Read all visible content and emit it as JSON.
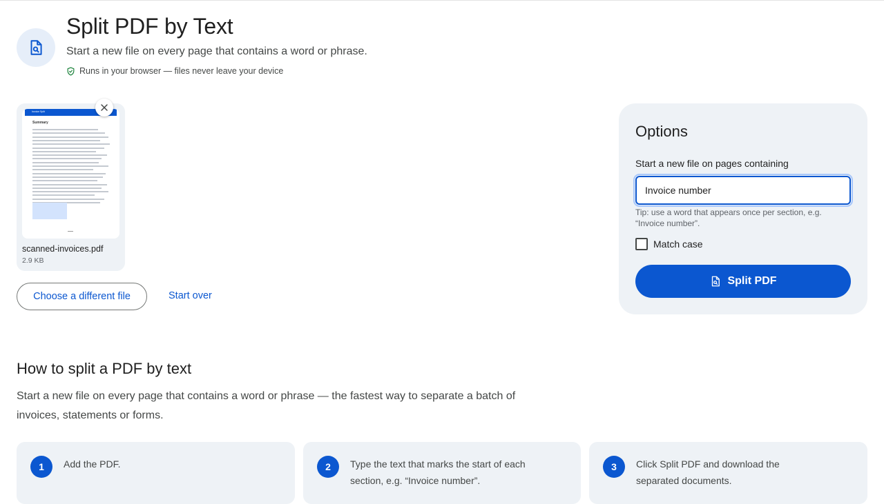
{
  "header": {
    "title": "Split PDF by Text",
    "subtitle": "Start a new file on every page that contains a word or phrase.",
    "privacy_note": "Runs in your browser — files never leave your device",
    "hero_icon": "file-search-icon",
    "privacy_icon": "shield-check-icon"
  },
  "file": {
    "name": "scanned-invoices.pdf",
    "size": "2.9 KB",
    "thumb_header": "Invoice Split",
    "thumb_heading": "Summary",
    "remove_icon": "close-icon"
  },
  "actions": {
    "choose_label": "Choose a different file",
    "start_over_label": "Start over"
  },
  "options": {
    "title": "Options",
    "field_label": "Start a new file on pages containing",
    "field_value": "Invoice number",
    "tip": "Tip: use a word that appears once per section, e.g. “Invoice number”.",
    "match_case_label": "Match case",
    "match_case_checked": false,
    "split_label": "Split PDF",
    "split_icon": "file-search-icon"
  },
  "howto": {
    "title": "How to split a PDF by text",
    "description": "Start a new file on every page that contains a word or phrase — the fastest way to separate a batch of invoices, statements or forms.",
    "steps": [
      {
        "number": "1",
        "text": "Add the PDF."
      },
      {
        "number": "2",
        "text": "Type the text that marks the start of each section, e.g. “Invoice number”."
      },
      {
        "number": "3",
        "text": "Click Split PDF and download the separated documents."
      }
    ]
  },
  "colors": {
    "accent": "#0b57d0",
    "panel": "#eef2f6",
    "hero_bg": "#e6eef9",
    "text": "#1f1f1f",
    "muted": "#444746"
  }
}
